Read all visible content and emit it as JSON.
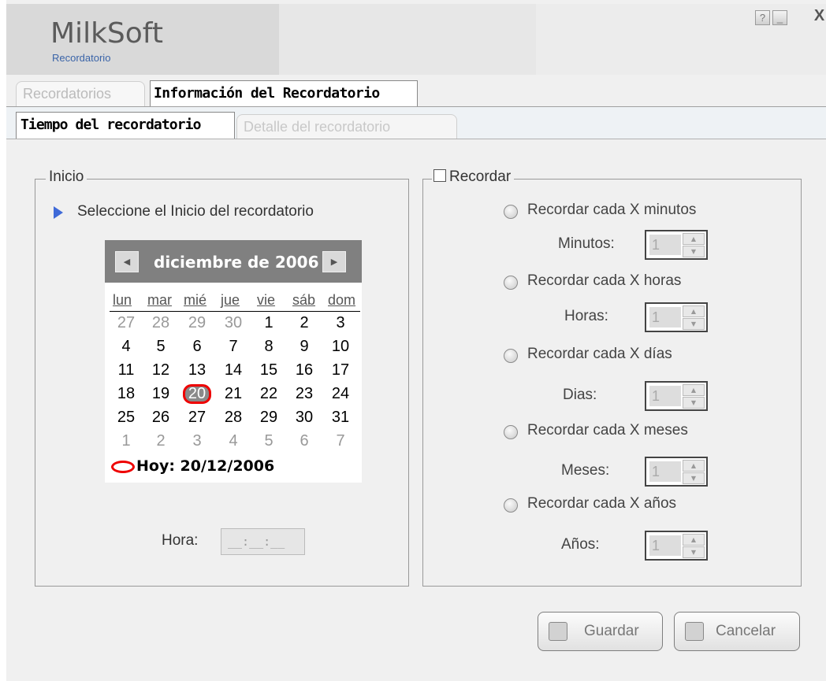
{
  "app": {
    "title": "MilkSoft",
    "subtitle": "Recordatorio"
  },
  "window_controls": {
    "help": "?",
    "minimize": "_",
    "close": "X"
  },
  "outer_tabs": [
    {
      "label": "Recordatorios",
      "active": false
    },
    {
      "label": "Información del Recordatorio",
      "active": true
    }
  ],
  "inner_tabs": [
    {
      "label": "Tiempo del recordatorio",
      "active": true
    },
    {
      "label": "Detalle del recordatorio",
      "active": false
    }
  ],
  "inicio": {
    "legend": "Inicio",
    "hint": "Seleccione el Inicio del recordatorio",
    "calendar": {
      "month_label": "diciembre de 2006",
      "weekdays": [
        "lun",
        "mar",
        "mié",
        "jue",
        "vie",
        "sáb",
        "dom"
      ],
      "weeks": [
        [
          "27",
          "28",
          "29",
          "30",
          "1",
          "2",
          "3"
        ],
        [
          "4",
          "5",
          "6",
          "7",
          "8",
          "9",
          "10"
        ],
        [
          "11",
          "12",
          "13",
          "14",
          "15",
          "16",
          "17"
        ],
        [
          "18",
          "19",
          "20",
          "21",
          "22",
          "23",
          "24"
        ],
        [
          "25",
          "26",
          "27",
          "28",
          "29",
          "30",
          "31"
        ],
        [
          "1",
          "2",
          "3",
          "4",
          "5",
          "6",
          "7"
        ]
      ],
      "selected_day": "20",
      "today_label": "Hoy: 20/12/2006"
    },
    "hora_label": "Hora:",
    "hora_value": "__:__:__"
  },
  "recordar": {
    "legend": "Recordar",
    "checked": false,
    "options": [
      {
        "radio_label": "Recordar cada X minutos",
        "field_label": "Minutos:",
        "value": "1"
      },
      {
        "radio_label": "Recordar cada X horas",
        "field_label": "Horas:",
        "value": "1"
      },
      {
        "radio_label": "Recordar cada X días",
        "field_label": "Dias:",
        "value": "1"
      },
      {
        "radio_label": "Recordar cada X meses",
        "field_label": "Meses:",
        "value": "1"
      },
      {
        "radio_label": "Recordar cada X años",
        "field_label": "Años:",
        "value": "1"
      }
    ]
  },
  "actions": {
    "save": "Guardar",
    "cancel": "Cancelar"
  }
}
